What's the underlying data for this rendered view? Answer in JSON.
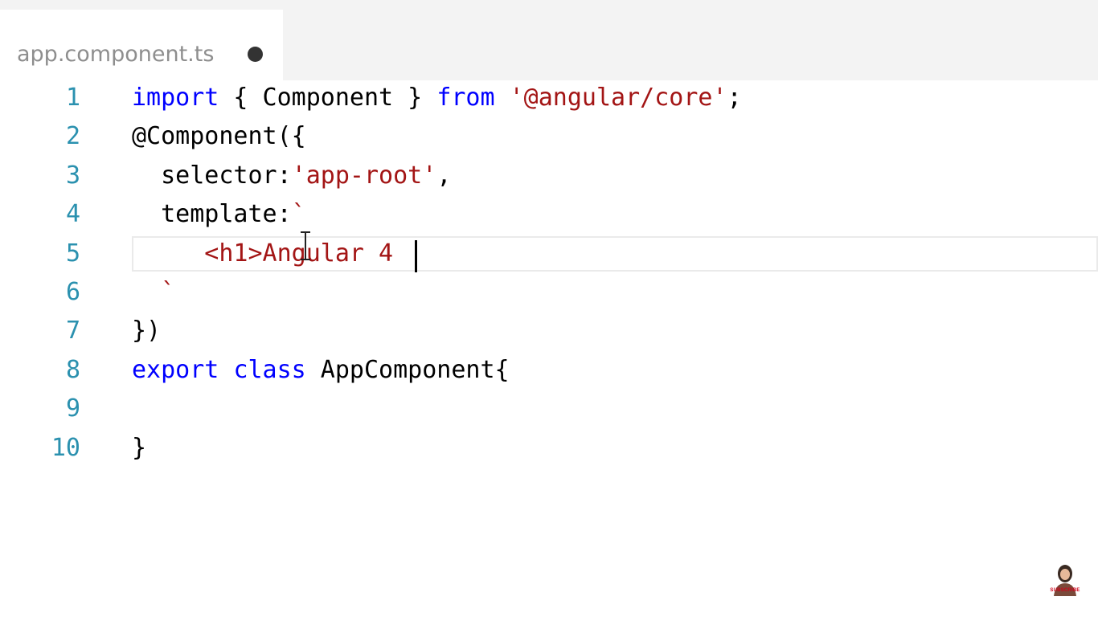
{
  "tab": {
    "filename": "app.component.ts",
    "unsaved": true
  },
  "colors": {
    "keyword": "#0000ff",
    "string": "#a31515",
    "line_number": "#2b91af",
    "text": "#000000"
  },
  "editor": {
    "cursor": {
      "line": 5
    },
    "lines": [
      {
        "number": "1",
        "tokens": [
          {
            "type": "keyword",
            "text": "import"
          },
          {
            "type": "plain",
            "text": " { Component } "
          },
          {
            "type": "keyword",
            "text": "from"
          },
          {
            "type": "plain",
            "text": " "
          },
          {
            "type": "string",
            "text": "'@angular/core'"
          },
          {
            "type": "plain",
            "text": ";"
          }
        ]
      },
      {
        "number": "2",
        "tokens": [
          {
            "type": "plain",
            "text": "@Component({"
          }
        ]
      },
      {
        "number": "3",
        "tokens": [
          {
            "type": "plain",
            "text": "  selector:"
          },
          {
            "type": "string",
            "text": "'app-root'"
          },
          {
            "type": "plain",
            "text": ","
          }
        ]
      },
      {
        "number": "4",
        "tokens": [
          {
            "type": "plain",
            "text": "  template:"
          },
          {
            "type": "string",
            "text": "`"
          }
        ]
      },
      {
        "number": "5",
        "tokens": [
          {
            "type": "string",
            "text": "     <h1>Angular 4"
          }
        ]
      },
      {
        "number": "6",
        "tokens": [
          {
            "type": "string",
            "text": "  `"
          }
        ]
      },
      {
        "number": "7",
        "tokens": [
          {
            "type": "plain",
            "text": "})"
          }
        ]
      },
      {
        "number": "8",
        "tokens": [
          {
            "type": "keyword",
            "text": "export"
          },
          {
            "type": "plain",
            "text": " "
          },
          {
            "type": "keyword",
            "text": "class"
          },
          {
            "type": "plain",
            "text": " AppComponent{"
          }
        ]
      },
      {
        "number": "9",
        "tokens": []
      },
      {
        "number": "10",
        "tokens": [
          {
            "type": "plain",
            "text": "}"
          }
        ]
      }
    ]
  },
  "watermark": {
    "label": "SUBSCRIBE"
  }
}
